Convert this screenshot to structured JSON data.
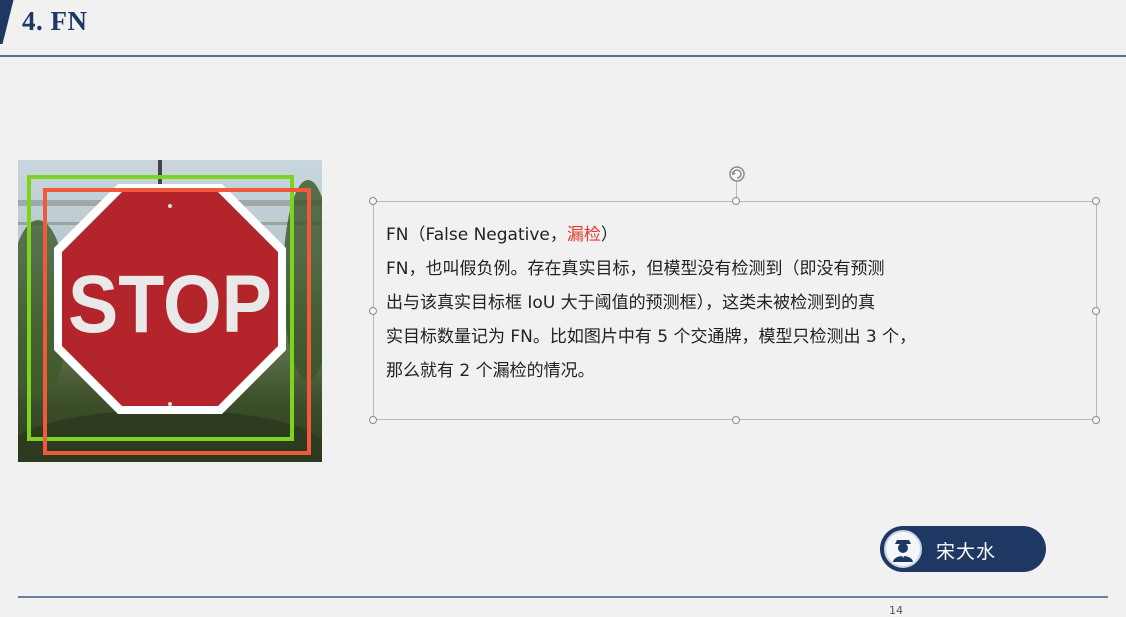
{
  "header": {
    "title": "4. FN"
  },
  "photo": {
    "sign_text": "STOP"
  },
  "textbox": {
    "line1_a": "FN（False Negative，",
    "line1_red": "漏检",
    "line1_b": "）",
    "line2": "FN，也叫假负例。存在真实目标，但模型没有检测到（即没有预测",
    "line3": "出与该真实目标框 IoU 大于阈值的预测框），这类未被检测到的真",
    "line4": "实目标数量记为 FN。比如图片中有 5 个交通牌，模型只检测出 3 个，",
    "line5": "那么就有 2 个漏检的情况。"
  },
  "presenter": {
    "name": "宋大水",
    "icon": "avatar-icon"
  },
  "footer": {
    "page_number": "14"
  },
  "colors": {
    "accent": "#1f3763",
    "highlight": "#e53b2c",
    "gt_box": "#7ed321",
    "pred_box": "#f0593b",
    "background": "#f1f1f1"
  }
}
